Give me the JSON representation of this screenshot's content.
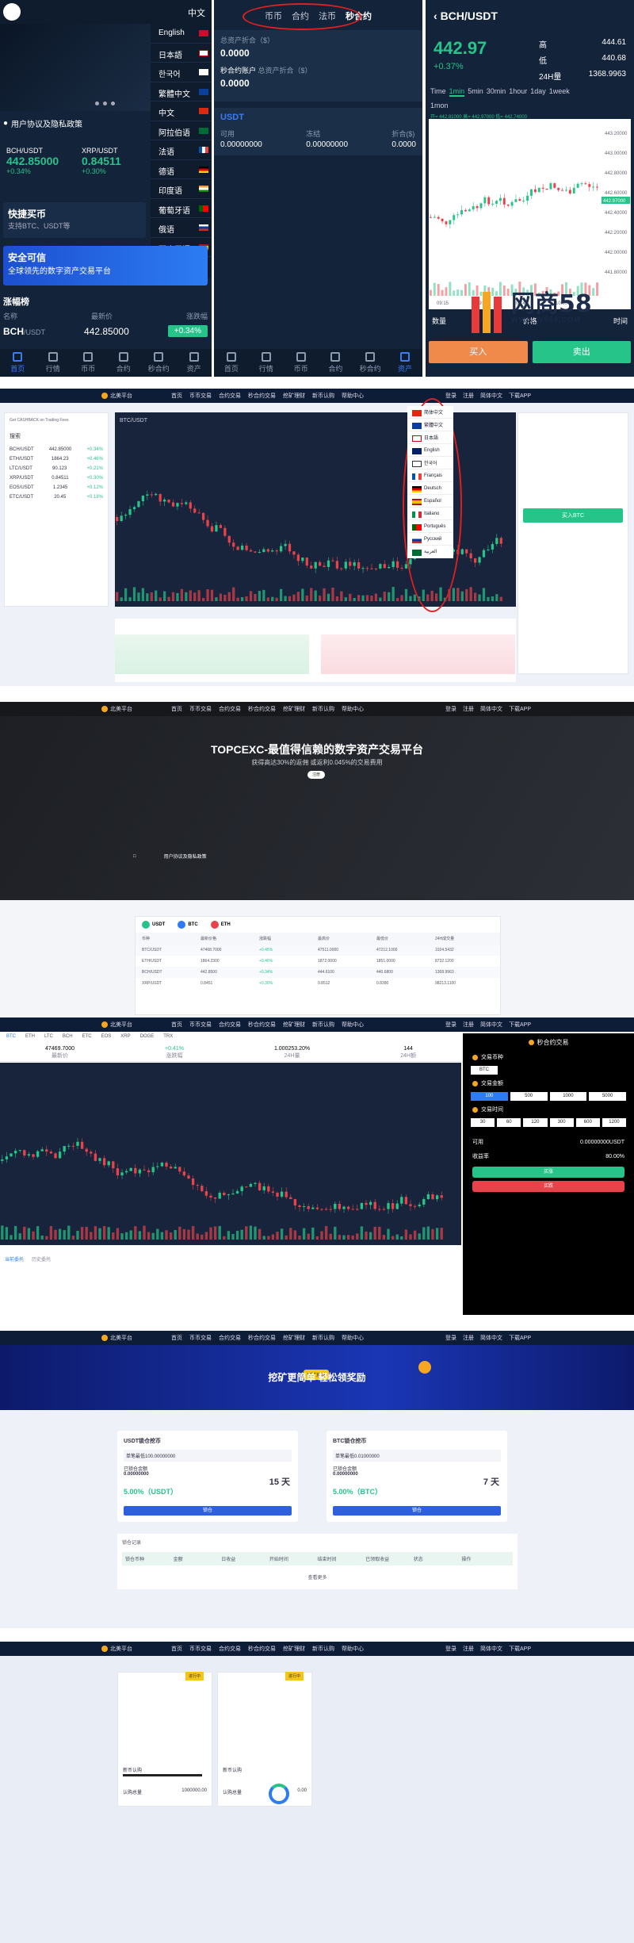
{
  "mobile_home": {
    "lang_current": "中文",
    "languages": [
      "English",
      "日本語",
      "한국어",
      "繁體中文",
      "中文",
      "阿拉伯语",
      "法语",
      "德语",
      "印度语",
      "葡萄牙语",
      "俄语",
      "西班牙语"
    ],
    "notice": "用户协议及隐私政策",
    "tickers": [
      {
        "pair": "BCH/USDT",
        "price": "442.85000",
        "change": "+0.34%"
      },
      {
        "pair": "XRP/USDT",
        "price": "0.84511",
        "change": "+0.30%"
      }
    ],
    "quick_buy_title": "快捷买币",
    "quick_buy_sub": "支持BTC、USDT等",
    "safe_title": "安全可信",
    "safe_sub": "全球领先的数字资产交易平台",
    "gainers_title": "涨幅榜",
    "table_headers": [
      "名称",
      "最新价",
      "涨跌幅"
    ],
    "row": {
      "pair": "BCH",
      "quote": "/USDT",
      "price": "442.85000",
      "change": "+0.34%"
    },
    "tabs": [
      "首页",
      "行情",
      "币币",
      "合约",
      "秒合约",
      "资产"
    ]
  },
  "mobile_assets": {
    "tabs": [
      "币币",
      "合约",
      "法币",
      "秒合约"
    ],
    "active_tab": "秒合约",
    "total_label": "总资产折合（$）",
    "total_value": "0.0000",
    "account_label": "秒合约账户",
    "account_sub": "总资产折合（$）",
    "account_value": "0.0000",
    "coin": "USDT",
    "cols": [
      "可用",
      "冻结",
      "折合($)"
    ],
    "vals": [
      "0.00000000",
      "0.00000000",
      "0.0000"
    ],
    "tabs_bottom": [
      "首页",
      "行情",
      "币币",
      "合约",
      "秒合约",
      "资产"
    ]
  },
  "mobile_chart": {
    "pair": "BCH/USDT",
    "price": "442.97",
    "change": "+0.37%",
    "high_label": "高",
    "high": "444.61",
    "low_label": "低",
    "low": "440.68",
    "vol_label": "24H量",
    "vol": "1368.9963",
    "intervals": [
      "Time",
      "1min",
      "5min",
      "30min",
      "1hour",
      "1day",
      "1week",
      "1mon"
    ],
    "active_interval": "1min",
    "ma_text": "开= 442.81000  高= 442.97000  低= 442.74000",
    "y_ticks": [
      "443.20000",
      "443.00000",
      "442.80000",
      "442.60000",
      "442.40000",
      "442.20000",
      "442.00000",
      "441.80000"
    ],
    "price_tag": "442.97000",
    "x_ticks": [
      "09:15",
      "09:30",
      "09:45",
      "10:00"
    ],
    "cols": [
      "数量",
      "价格",
      "时间"
    ],
    "buy": "买入",
    "sell": "卖出"
  },
  "desktop_nav": {
    "logo": "北美平台",
    "items": [
      "首页",
      "币币交易",
      "合约交易",
      "秒合约交易",
      "挖矿理财",
      "新币认购",
      "帮助中心"
    ],
    "right": [
      "登录",
      "注册",
      "简体中文",
      "下载APP"
    ]
  },
  "desktop_lang_menu": [
    "简体中文",
    "繁體中文",
    "日本語",
    "English",
    "한국어",
    "Français",
    "Deutsch",
    "Español",
    "Italiano",
    "Português",
    "Русский",
    "العربية"
  ],
  "desktop_trade": {
    "pair": "BTC/USDT",
    "banner": "Get CASHBACK on Trading Fees",
    "search": "搜索",
    "markets": [
      {
        "pair": "BCH/USDT",
        "price": "442.85000",
        "chg": "+0.34%"
      },
      {
        "pair": "ETH/USDT",
        "price": "1864.23",
        "chg": "+0.46%"
      },
      {
        "pair": "LTC/USDT",
        "price": "90.123",
        "chg": "+0.21%"
      },
      {
        "pair": "XRP/USDT",
        "price": "0.84511",
        "chg": "+0.30%"
      },
      {
        "pair": "EOS/USDT",
        "price": "1.2345",
        "chg": "+0.12%"
      },
      {
        "pair": "ETC/USDT",
        "price": "20.45",
        "chg": "+0.18%"
      }
    ],
    "buy_btn": "买入BTC"
  },
  "hero": {
    "title": "TOPCEXC-最值得信赖的数字资产交易平台",
    "sub": "获得高达30%的返佣 或返利0.045%的交易费用",
    "pill": "注册",
    "notice": "用户协议及隐私政策"
  },
  "market_table": {
    "tabs": [
      "USDT",
      "BTC",
      "ETH"
    ],
    "headers": [
      "币种",
      "最新价格",
      "涨跌幅",
      "最高价",
      "最低价",
      "24H成交量"
    ],
    "rows": [
      [
        "BTC/USDT",
        "47468.7000",
        "+0.45%",
        "47511.0000",
        "47212.1000",
        "1024.5432"
      ],
      [
        "ETH/USDT",
        "1864.2300",
        "+0.46%",
        "1872.0000",
        "1851.0000",
        "8732.1200"
      ],
      [
        "BCH/USDT",
        "442.8500",
        "+0.34%",
        "444.6100",
        "440.6800",
        "1368.9963"
      ],
      [
        "XRP/USDT",
        "0.8451",
        "+0.30%",
        "0.8512",
        "0.8390",
        "98213.1100"
      ]
    ]
  },
  "trade_pro": {
    "pairs": [
      "BTC",
      "ETH",
      "LTC",
      "BCH",
      "ETC",
      "EOS",
      "XRP",
      "DOGE",
      "TRX"
    ],
    "stats": [
      {
        "v": "47469.7000",
        "l": "最新价"
      },
      {
        "v": "+0.41%",
        "l": "涨跌幅"
      },
      {
        "v": "1.000253.20%",
        "l": "24H量"
      },
      {
        "v": "144",
        "l": "24H额"
      }
    ],
    "side_title": "秒合约交易",
    "labels": [
      "交易币种",
      "交易金额",
      "交易时间"
    ],
    "amounts": [
      "100",
      "500",
      "1000",
      "5000"
    ],
    "times": [
      "30",
      "60",
      "120",
      "300",
      "600",
      "1200"
    ],
    "avail_label": "可用",
    "avail": "0.00000000USDT",
    "rate_label": "收益率",
    "rate": "80.00%",
    "up": "买涨",
    "down": "买跌",
    "tabs_bottom": [
      "当前委托",
      "历史委托"
    ]
  },
  "mining": {
    "tag": "挖矿理财",
    "title": "挖矿更简单 轻松领奖励",
    "cards": [
      {
        "title": "USDT锁仓挖币",
        "min": "单笔最低100.00000000",
        "label": "已锁仓金额",
        "amount": "0.00000000",
        "rate": "5.00%（USDT）",
        "days": "15 天",
        "btn": "锁仓"
      },
      {
        "title": "BTC锁仓挖币",
        "min": "单笔最低0.01000000",
        "label": "已锁仓金额",
        "amount": "0.00000000",
        "rate": "5.00%（BTC）",
        "days": "7 天",
        "btn": "锁仓"
      }
    ],
    "records_title": "锁仓记录",
    "records_headers": [
      "锁仓币种",
      "金额",
      "日收益",
      "开始时间",
      "结束时间",
      "已领取收益",
      "状态",
      "操作"
    ],
    "more": "查看更多"
  },
  "ido": {
    "cards": [
      {
        "badge": "进行中",
        "name": "新币认购",
        "price": "1000000.00",
        "sub": "认购总量"
      },
      {
        "badge": "进行中",
        "name": "新币认购",
        "price": "0.00",
        "sub": "认购总量"
      }
    ]
  },
  "watermark": {
    "text": "网商58",
    "url": "WWW.WS58.COM"
  },
  "colors": {
    "green": "#27c48a",
    "red": "#e8424b",
    "orange": "#f08a4b",
    "blue": "#2d7cf3",
    "navy": "#13233a"
  }
}
